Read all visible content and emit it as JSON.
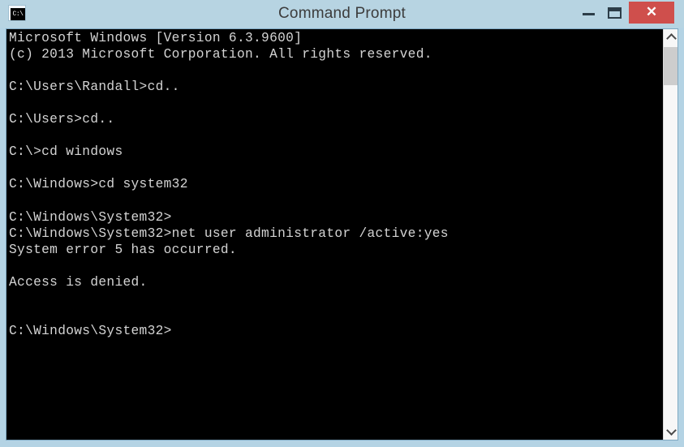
{
  "window": {
    "title": "Command Prompt",
    "icon_name": "command-prompt-icon",
    "icon_glyph": "C:\\",
    "frame_color": "#b4d3e4",
    "titlebar_color": "#b7d4e2",
    "title_text_color": "#3c3c3c",
    "controls": {
      "minimize_label": "–",
      "maximize_label": "❑",
      "close_label": "✕",
      "close_color": "#cf4f4c"
    }
  },
  "console": {
    "background_color": "#000000",
    "text_color": "#d4d4d4",
    "lines": [
      "Microsoft Windows [Version 6.3.9600]",
      "(c) 2013 Microsoft Corporation. All rights reserved.",
      "",
      "C:\\Users\\Randall>cd..",
      "",
      "C:\\Users>cd..",
      "",
      "C:\\>cd windows",
      "",
      "C:\\Windows>cd system32",
      "",
      "C:\\Windows\\System32>",
      "C:\\Windows\\System32>net user administrator /active:yes",
      "System error 5 has occurred.",
      "",
      "Access is denied.",
      "",
      "",
      "C:\\Windows\\System32>"
    ],
    "text": "Microsoft Windows [Version 6.3.9600]\n(c) 2013 Microsoft Corporation. All rights reserved.\n\nC:\\Users\\Randall>cd..\n\nC:\\Users>cd..\n\nC:\\>cd windows\n\nC:\\Windows>cd system32\n\nC:\\Windows\\System32>\nC:\\Windows\\System32>net user administrator /active:yes\nSystem error 5 has occurred.\n\nAccess is denied.\n\n\nC:\\Windows\\System32>"
  },
  "scrollbar": {
    "up_arrow_name": "scroll-up-arrow",
    "down_arrow_name": "scroll-down-arrow",
    "thumb_color": "#cdcdcd",
    "track_color": "#f7f7f7"
  }
}
